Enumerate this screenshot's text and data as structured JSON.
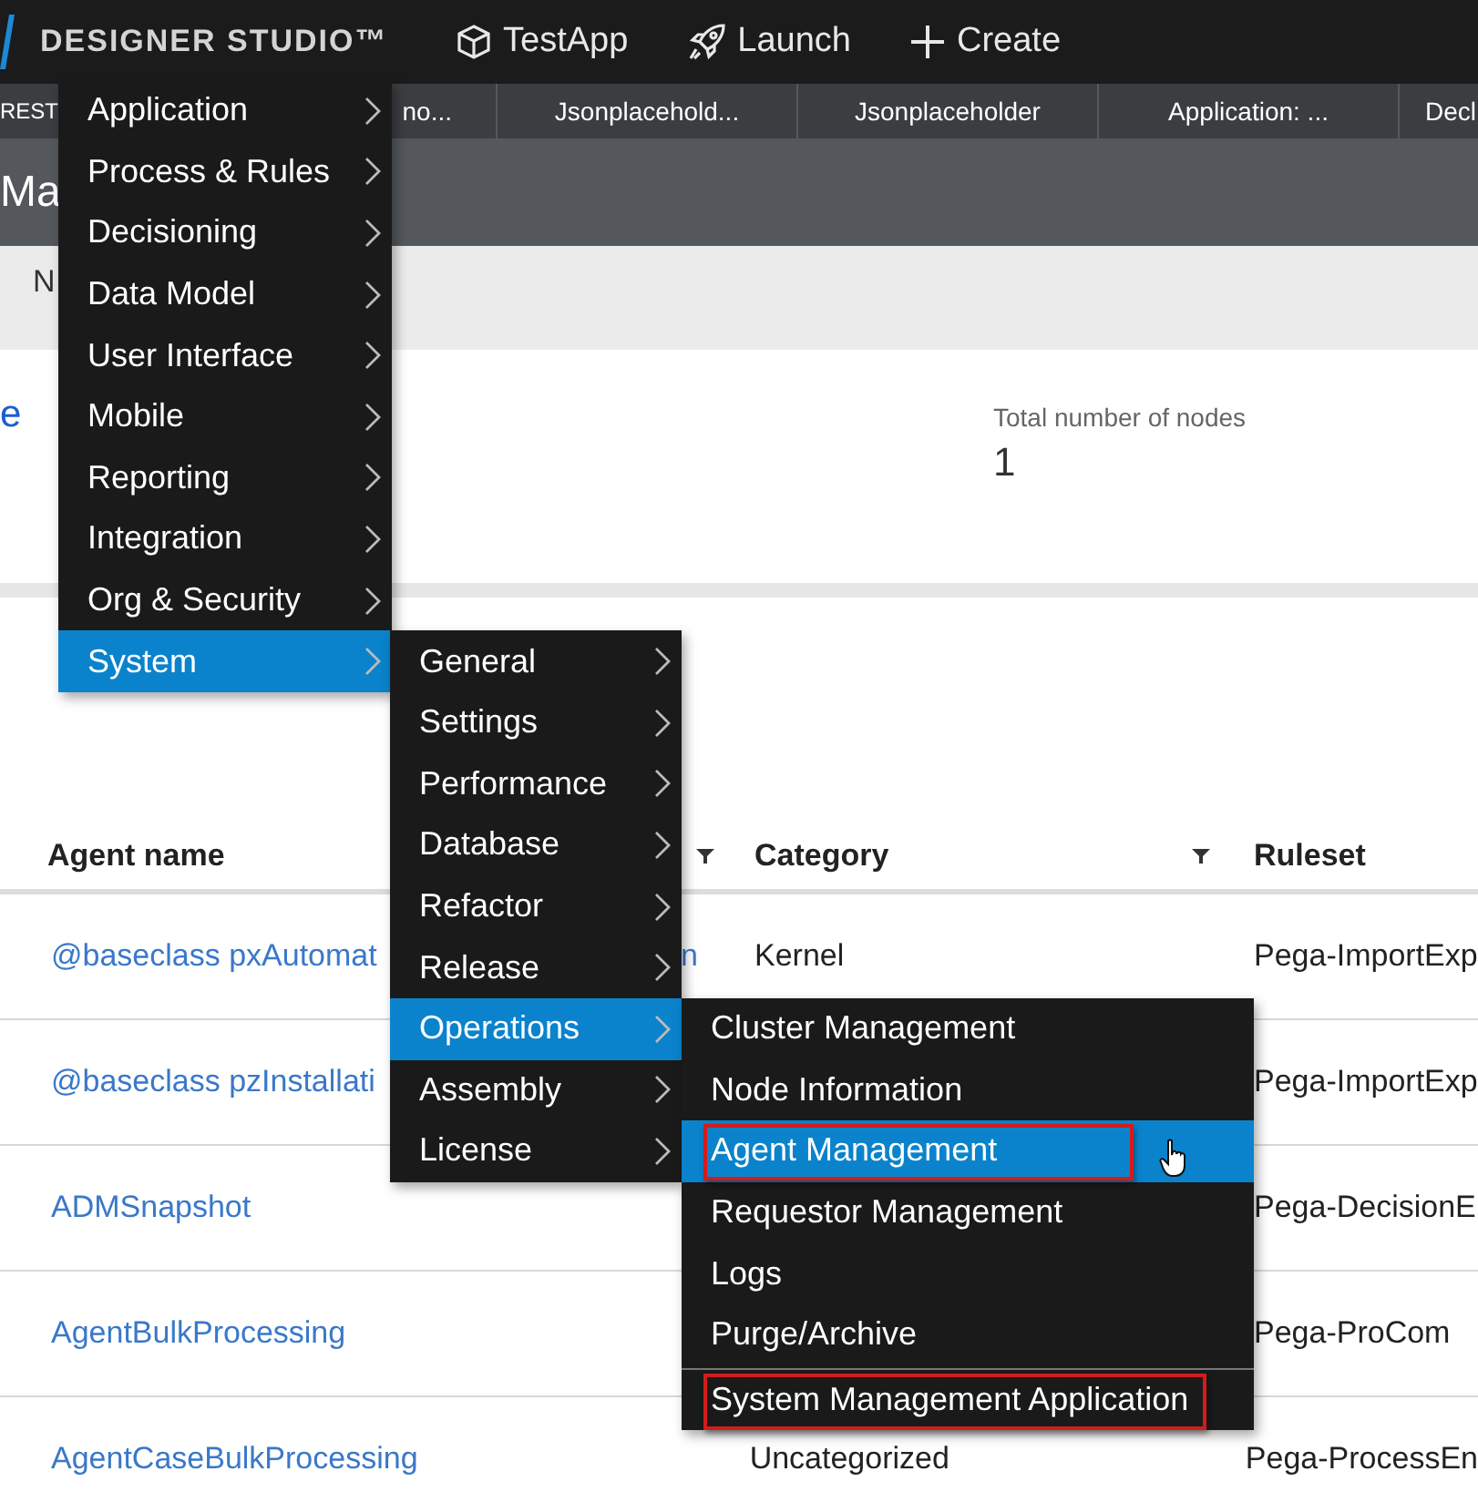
{
  "header": {
    "title": "DESIGNER STUDIO™",
    "actions": [
      {
        "label": "TestApp",
        "kind": "cube"
      },
      {
        "label": "Launch",
        "kind": "rocket"
      },
      {
        "label": "Create",
        "kind": "plus"
      }
    ]
  },
  "tabs": [
    {
      "label": "REST"
    },
    {
      "label": "no..."
    },
    {
      "label": "Jsonplacehold..."
    },
    {
      "label": "Jsonplaceholder"
    },
    {
      "label": "Application: ..."
    },
    {
      "label": "Decl"
    }
  ],
  "page_title": "Ma",
  "subheader": "N",
  "summary": {
    "link_fragment": "e",
    "label": "Total number of nodes",
    "value": "1"
  },
  "table": {
    "columns": [
      {
        "label": "Agent name",
        "filter": true
      },
      {
        "label": "Category",
        "filter": true
      },
      {
        "label": "Ruleset",
        "filter": false
      }
    ],
    "rows": [
      {
        "name": "@baseclass pxAutomat",
        "name_tail": "n",
        "category": "Kernel",
        "ruleset": "Pega-ImportExp"
      },
      {
        "name": "@baseclass pzInstallati",
        "ruleset": "Pega-ImportExp"
      },
      {
        "name": "ADMSnapshot",
        "ruleset": "Pega-DecisionE"
      },
      {
        "name": "AgentBulkProcessing",
        "ruleset": "Pega-ProCom"
      },
      {
        "name": "AgentCaseBulkProcessing",
        "category": "Uncategorized",
        "ruleset": "Pega-ProcessEn"
      }
    ]
  },
  "menu": {
    "items": [
      {
        "label": "Application",
        "submenu": true,
        "selected": false
      },
      {
        "label": "Process & Rules",
        "submenu": true,
        "selected": false
      },
      {
        "label": "Decisioning",
        "submenu": true,
        "selected": false
      },
      {
        "label": "Data Model",
        "submenu": true,
        "selected": false
      },
      {
        "label": "User Interface",
        "submenu": true,
        "selected": false
      },
      {
        "label": "Mobile",
        "submenu": true,
        "selected": false
      },
      {
        "label": "Reporting",
        "submenu": true,
        "selected": false
      },
      {
        "label": "Integration",
        "submenu": true,
        "selected": false
      },
      {
        "label": "Org & Security",
        "submenu": true,
        "selected": false
      },
      {
        "label": "System",
        "submenu": true,
        "selected": true,
        "children": [
          {
            "label": "General",
            "submenu": true,
            "selected": false
          },
          {
            "label": "Settings",
            "submenu": true,
            "selected": false
          },
          {
            "label": "Performance",
            "submenu": true,
            "selected": false
          },
          {
            "label": "Database",
            "submenu": true,
            "selected": false
          },
          {
            "label": "Refactor",
            "submenu": true,
            "selected": false
          },
          {
            "label": "Release",
            "submenu": true,
            "selected": false
          },
          {
            "label": "Operations",
            "submenu": true,
            "selected": true,
            "children": [
              {
                "label": "Cluster Management",
                "selected": false,
                "annotated": false,
                "separator_before": false
              },
              {
                "label": "Node Information",
                "selected": false,
                "annotated": false,
                "separator_before": false
              },
              {
                "label": "Agent Management",
                "selected": true,
                "annotated": true,
                "separator_before": false
              },
              {
                "label": "Requestor Management",
                "selected": false,
                "annotated": false,
                "separator_before": false
              },
              {
                "label": "Logs",
                "selected": false,
                "annotated": false,
                "separator_before": false
              },
              {
                "label": "Purge/Archive",
                "selected": false,
                "annotated": false,
                "separator_before": false
              },
              {
                "label": "System Management Application",
                "selected": false,
                "annotated": true,
                "separator_before": true
              }
            ]
          },
          {
            "label": "Assembly",
            "submenu": true,
            "selected": false
          },
          {
            "label": "License",
            "submenu": true,
            "selected": false
          }
        ]
      }
    ]
  }
}
